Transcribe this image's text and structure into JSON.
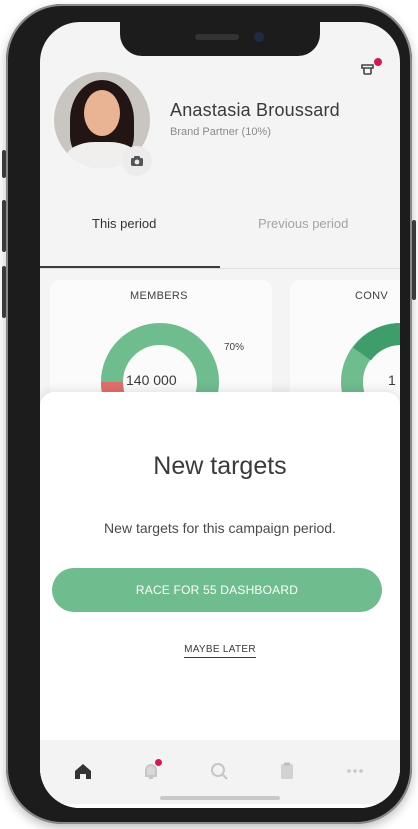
{
  "profile": {
    "name": "Anastasia Broussard",
    "subtitle": "Brand Partner (10%)"
  },
  "tabs": [
    {
      "label": "This period"
    },
    {
      "label": "Previous period"
    }
  ],
  "cards": [
    {
      "title": "MEMBERS",
      "percent": "70%",
      "value": "140 000"
    },
    {
      "title": "CONV",
      "value": "1"
    }
  ],
  "modal": {
    "title": "New targets",
    "text": "New targets for this campaign period.",
    "primary": "RACE FOR 55 DASHBOARD",
    "secondary": "MAYBE LATER"
  },
  "colors": {
    "accent": "#6fbc8e",
    "badge": "#d1185b",
    "donut_red": "#e06f6a"
  },
  "icons": {
    "top": "notification-icon",
    "avatar_action": "camera-icon",
    "nav": [
      "home-icon",
      "bell-icon",
      "search-icon",
      "clipboard-icon",
      "more-icon"
    ]
  }
}
